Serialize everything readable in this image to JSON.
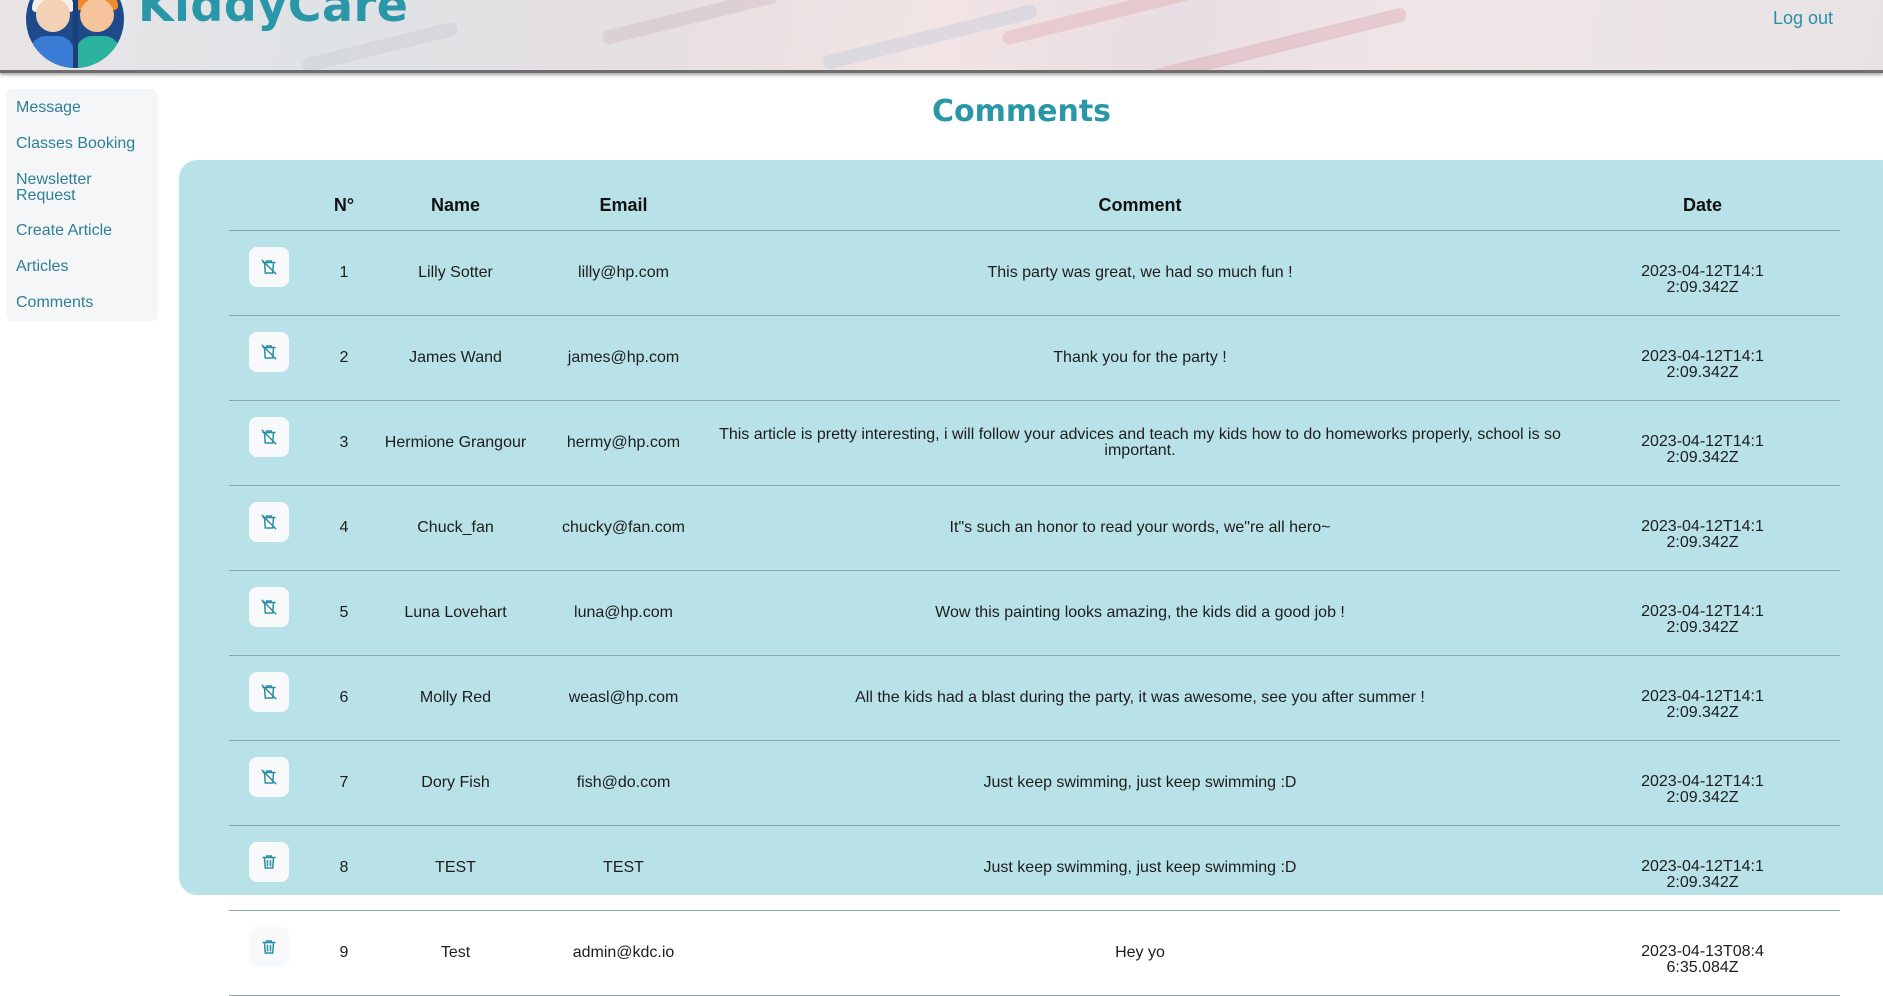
{
  "header": {
    "brand": "KiddyCare",
    "logout_label": "Log out"
  },
  "sidebar": {
    "items": [
      {
        "label": "Message"
      },
      {
        "label": "Classes Booking"
      },
      {
        "label": "Newsletter Request"
      },
      {
        "label": "Create Article"
      },
      {
        "label": "Articles"
      },
      {
        "label": "Comments"
      }
    ]
  },
  "page": {
    "title": "Comments"
  },
  "table": {
    "headers": [
      "",
      "N°",
      "Name",
      "Email",
      "Comment",
      "Date"
    ],
    "rows": [
      {
        "icon": "delete-forbidden-icon",
        "n": "1",
        "name": "Lilly Sotter",
        "email": "lilly@hp.com",
        "comment": "This party was great, we had so much fun !",
        "date": "2023-04-12T14:12:09.342Z"
      },
      {
        "icon": "delete-forbidden-icon",
        "n": "2",
        "name": "James Wand",
        "email": "james@hp.com",
        "comment": "Thank you for the party !",
        "date": "2023-04-12T14:12:09.342Z"
      },
      {
        "icon": "delete-forbidden-icon",
        "n": "3",
        "name": "Hermione Grangour",
        "email": "hermy@hp.com",
        "comment": "This article is pretty interesting, i will follow your advices and teach my kids how to do homeworks properly, school is so important.",
        "date": "2023-04-12T14:12:09.342Z"
      },
      {
        "icon": "delete-forbidden-icon",
        "n": "4",
        "name": "Chuck_fan",
        "email": "chucky@fan.com",
        "comment": "It\"s such an honor to read your words, we\"re all hero~",
        "date": "2023-04-12T14:12:09.342Z"
      },
      {
        "icon": "delete-forbidden-icon",
        "n": "5",
        "name": "Luna Lovehart",
        "email": "luna@hp.com",
        "comment": "Wow this painting looks amazing, the kids did a good job !",
        "date": "2023-04-12T14:12:09.342Z"
      },
      {
        "icon": "delete-forbidden-icon",
        "n": "6",
        "name": "Molly Red",
        "email": "weasl@hp.com",
        "comment": "All the kids had a blast during the party, it was awesome, see you after summer !",
        "date": "2023-04-12T14:12:09.342Z"
      },
      {
        "icon": "delete-forbidden-icon",
        "n": "7",
        "name": "Dory Fish",
        "email": "fish@do.com",
        "comment": "Just keep swimming, just keep swimming :D",
        "date": "2023-04-12T14:12:09.342Z"
      },
      {
        "icon": "trash-icon",
        "n": "8",
        "name": "TEST",
        "email": "TEST",
        "comment": "Just keep swimming, just keep swimming :D",
        "date": "2023-04-12T14:12:09.342Z"
      },
      {
        "icon": "trash-icon",
        "n": "9",
        "name": "Test",
        "email": "admin@kdc.io",
        "comment": "Hey yo",
        "date": "2023-04-13T08:46:35.084Z"
      }
    ]
  },
  "colors": {
    "accent": "#2a97a8",
    "card_bg": "#b8e1e8",
    "icon": "#2a8fa6"
  }
}
